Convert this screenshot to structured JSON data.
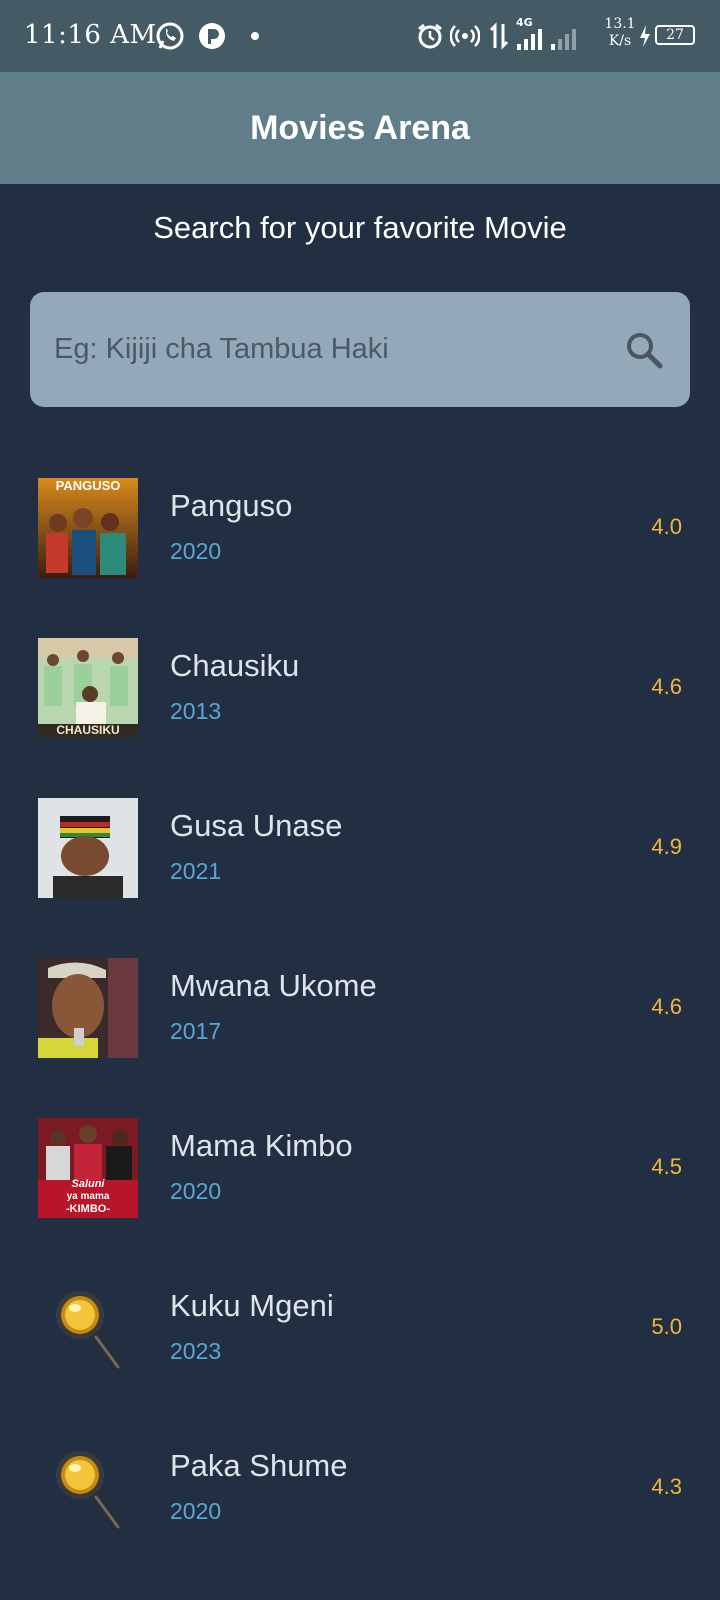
{
  "status_bar": {
    "time": "11:16 AM",
    "network_speed_value": "13.1",
    "network_speed_unit": "K/s",
    "battery": "27",
    "signal_label": "4G",
    "icons": [
      "whatsapp-icon",
      "p-app-icon",
      "notification-dot-icon",
      "alarm-icon",
      "hotspot-icon",
      "data-arrows-icon",
      "signal-icon",
      "charging-icon",
      "battery-icon"
    ]
  },
  "app_bar": {
    "title": "Movies Arena"
  },
  "search": {
    "heading": "Search for your favorite Movie",
    "placeholder": "Eg: Kijiji cha Tambua Haki",
    "value": "",
    "icon": "search-icon"
  },
  "poster_texts": {
    "panguso": "PANGUSO",
    "chausiku": "CHAUSIKU",
    "mama_kimbo_line1": "Saluni",
    "mama_kimbo_line2": "ya mama",
    "mama_kimbo_line3": "-KIMBO-"
  },
  "movies": [
    {
      "title": "Panguso",
      "year": "2020",
      "rating": "4.0",
      "poster": "poster-image"
    },
    {
      "title": "Chausiku",
      "year": "2013",
      "rating": "4.6",
      "poster": "poster-image"
    },
    {
      "title": "Gusa Unase",
      "year": "2021",
      "rating": "4.9",
      "poster": "poster-image"
    },
    {
      "title": "Mwana Ukome",
      "year": "2017",
      "rating": "4.6",
      "poster": "poster-image"
    },
    {
      "title": "Mama Kimbo",
      "year": "2020",
      "rating": "4.5",
      "poster": "poster-image"
    },
    {
      "title": "Kuku Mgeni",
      "year": "2023",
      "rating": "5.0",
      "poster": "magnifier-placeholder-icon"
    },
    {
      "title": "Paka Shume",
      "year": "2020",
      "rating": "4.3",
      "poster": "magnifier-placeholder-icon"
    }
  ],
  "colors": {
    "background": "#222e42",
    "status_bar": "#445a64",
    "app_bar": "#607d8a",
    "search_box": "#93a9ba",
    "title_text": "#dfe3ea",
    "year_text": "#5aa7d6",
    "rating_text": "#f0b83a"
  }
}
